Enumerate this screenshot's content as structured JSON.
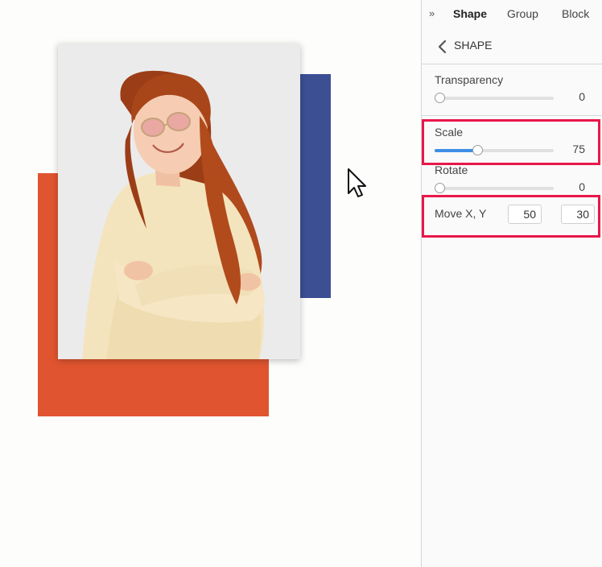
{
  "tabs": [
    {
      "label": "Shape",
      "active": true
    },
    {
      "label": "Group",
      "active": false
    },
    {
      "label": "Block",
      "active": false
    }
  ],
  "collapse_icon_glyph": "»",
  "section": {
    "title": "SHAPE",
    "back_icon": "chevron-left-icon"
  },
  "controls": {
    "transparency": {
      "label": "Transparency",
      "value": "0",
      "fraction": 0.0
    },
    "scale": {
      "label": "Scale",
      "value": "75",
      "fraction": 0.36
    },
    "rotate": {
      "label": "Rotate",
      "value": "0",
      "fraction": 0.0
    },
    "move": {
      "label": "Move X, Y",
      "x": "50",
      "y": "30"
    }
  },
  "colors": {
    "orange_rect": "#e05530",
    "blue_rect": "#3d4f93",
    "slider_fill": "#3f8ee6",
    "highlight": "#e8174a"
  },
  "canvas": {
    "photo": "smiling woman with red hair and sunglasses in yellow hoodie",
    "cursor_icon": "arrow-cursor-icon"
  }
}
